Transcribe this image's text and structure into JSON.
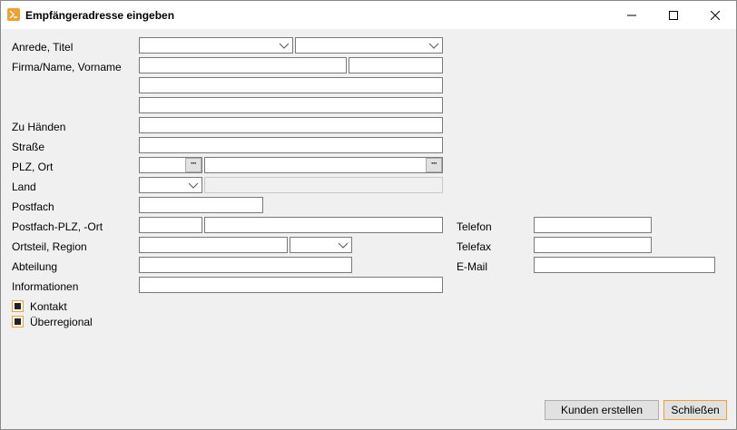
{
  "window": {
    "title": "Empfängeradresse eingeben",
    "accent_color": "#f0a030"
  },
  "form": {
    "labels": {
      "anrede": "Anrede, Titel",
      "firma": "Firma/Name, Vorname",
      "zu_haenden": "Zu Händen",
      "strasse": "Straße",
      "plz_ort": "PLZ, Ort",
      "land": "Land",
      "postfach": "Postfach",
      "postfach_plz": "Postfach-PLZ, -Ort",
      "ortsteil": "Ortsteil, Region",
      "abteilung": "Abteilung",
      "informationen": "Informationen",
      "telefon": "Telefon",
      "telefax": "Telefax",
      "email": "E-Mail"
    },
    "values": {
      "anrede": "",
      "titel": "",
      "firma": "",
      "vorname": "",
      "name2": "",
      "name3": "",
      "zu_haenden": "",
      "strasse": "",
      "plz": "",
      "ort": "",
      "land": "",
      "land_name": "",
      "postfach": "",
      "postfach_plz": "",
      "postfach_ort": "",
      "ortsteil": "",
      "region": "",
      "abteilung": "",
      "informationen": "",
      "telefon": "",
      "telefax": "",
      "email": ""
    },
    "lookup_button_label": "···"
  },
  "checkboxes": [
    {
      "label": "Kontakt",
      "checked": true
    },
    {
      "label": "Überregional",
      "checked": true
    }
  ],
  "buttons": {
    "create_customer": "Kunden erstellen",
    "close": "Schließen"
  }
}
